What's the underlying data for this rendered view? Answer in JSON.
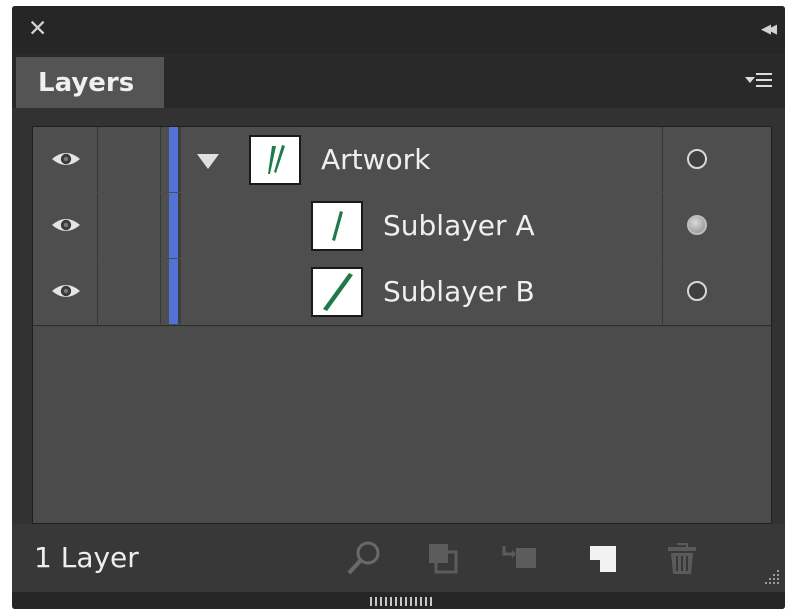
{
  "window": {
    "close_icon": "close-icon",
    "collapse_icon": "double-chevron-left-icon"
  },
  "panel": {
    "tab_label": "Layers",
    "menu_icon": "panel-menu-icon"
  },
  "layers": [
    {
      "name": "Artwork",
      "visible": true,
      "expanded": true,
      "is_sublayer": false,
      "color": "#5272d6",
      "target_selected": false
    },
    {
      "name": "Sublayer A",
      "visible": true,
      "is_sublayer": true,
      "color": "#5272d6",
      "target_selected": true
    },
    {
      "name": "Sublayer B",
      "visible": true,
      "is_sublayer": true,
      "color": "#5272d6",
      "target_selected": false
    }
  ],
  "footer": {
    "layer_count": "1 Layer",
    "buttons": [
      {
        "icon": "locate-object-icon",
        "enabled": false
      },
      {
        "icon": "make-clipping-mask-icon",
        "enabled": false
      },
      {
        "icon": "create-sublayer-icon",
        "enabled": false
      },
      {
        "icon": "create-new-layer-icon",
        "enabled": true
      },
      {
        "icon": "trash-icon",
        "enabled": false
      }
    ]
  }
}
